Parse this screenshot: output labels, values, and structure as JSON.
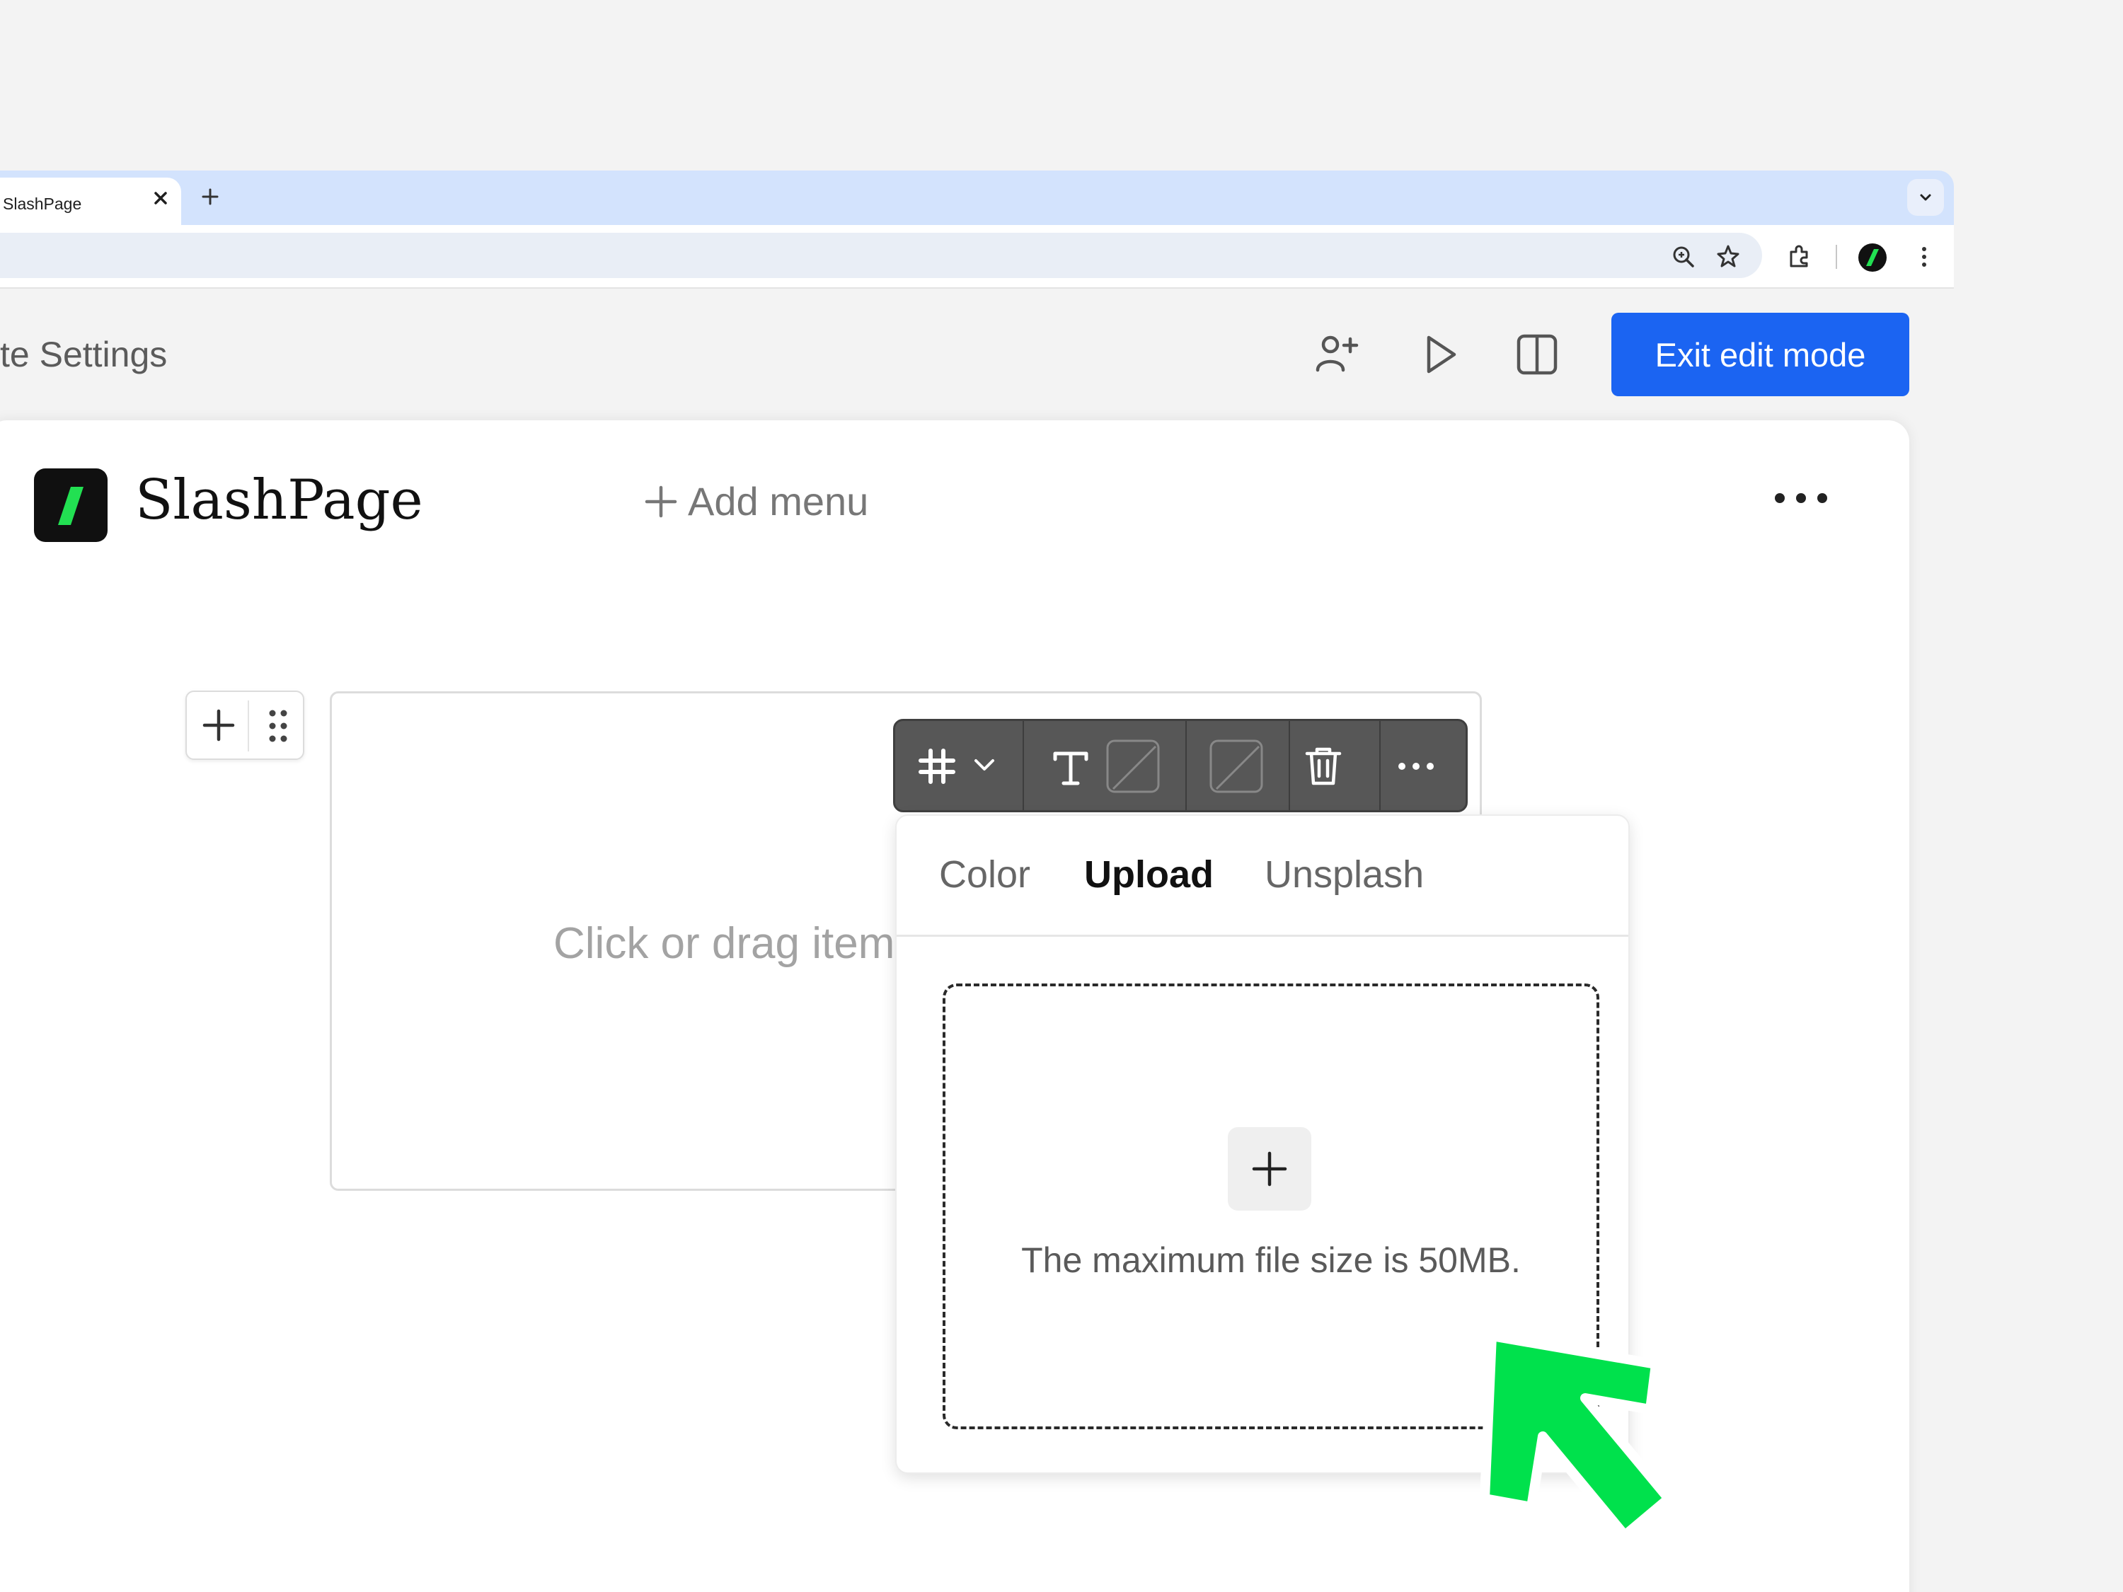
{
  "browser": {
    "tab_title": "SlashPage",
    "tab_close": "×",
    "new_tab": "+"
  },
  "app_header": {
    "site_settings_label": "te Settings",
    "exit_button_label": "Exit edit mode"
  },
  "site": {
    "name": "SlashPage",
    "add_menu_label": "Add menu"
  },
  "block": {
    "hint": "Click or drag item"
  },
  "background_popover": {
    "tabs": [
      {
        "label": "Color",
        "active": false
      },
      {
        "label": "Upload",
        "active": true
      },
      {
        "label": "Unsplash",
        "active": false
      }
    ],
    "upload_hint": "The maximum file size is 50MB."
  },
  "colors": {
    "accent_blue": "#1b64f2",
    "brand_green": "#22e052",
    "arrow_green": "#00e14c",
    "tabstrip_blue": "#d3e3fd"
  },
  "icons": [
    "close-icon",
    "plus-icon",
    "chevron-down-icon",
    "zoom-icon",
    "star-icon",
    "extensions-icon",
    "kebab-icon",
    "add-user-icon",
    "play-icon",
    "split-view-icon",
    "more-icon",
    "drag-handle-icon",
    "layout-icon",
    "text-icon",
    "slash-box-icon",
    "trash-icon",
    "arrow-icon"
  ]
}
